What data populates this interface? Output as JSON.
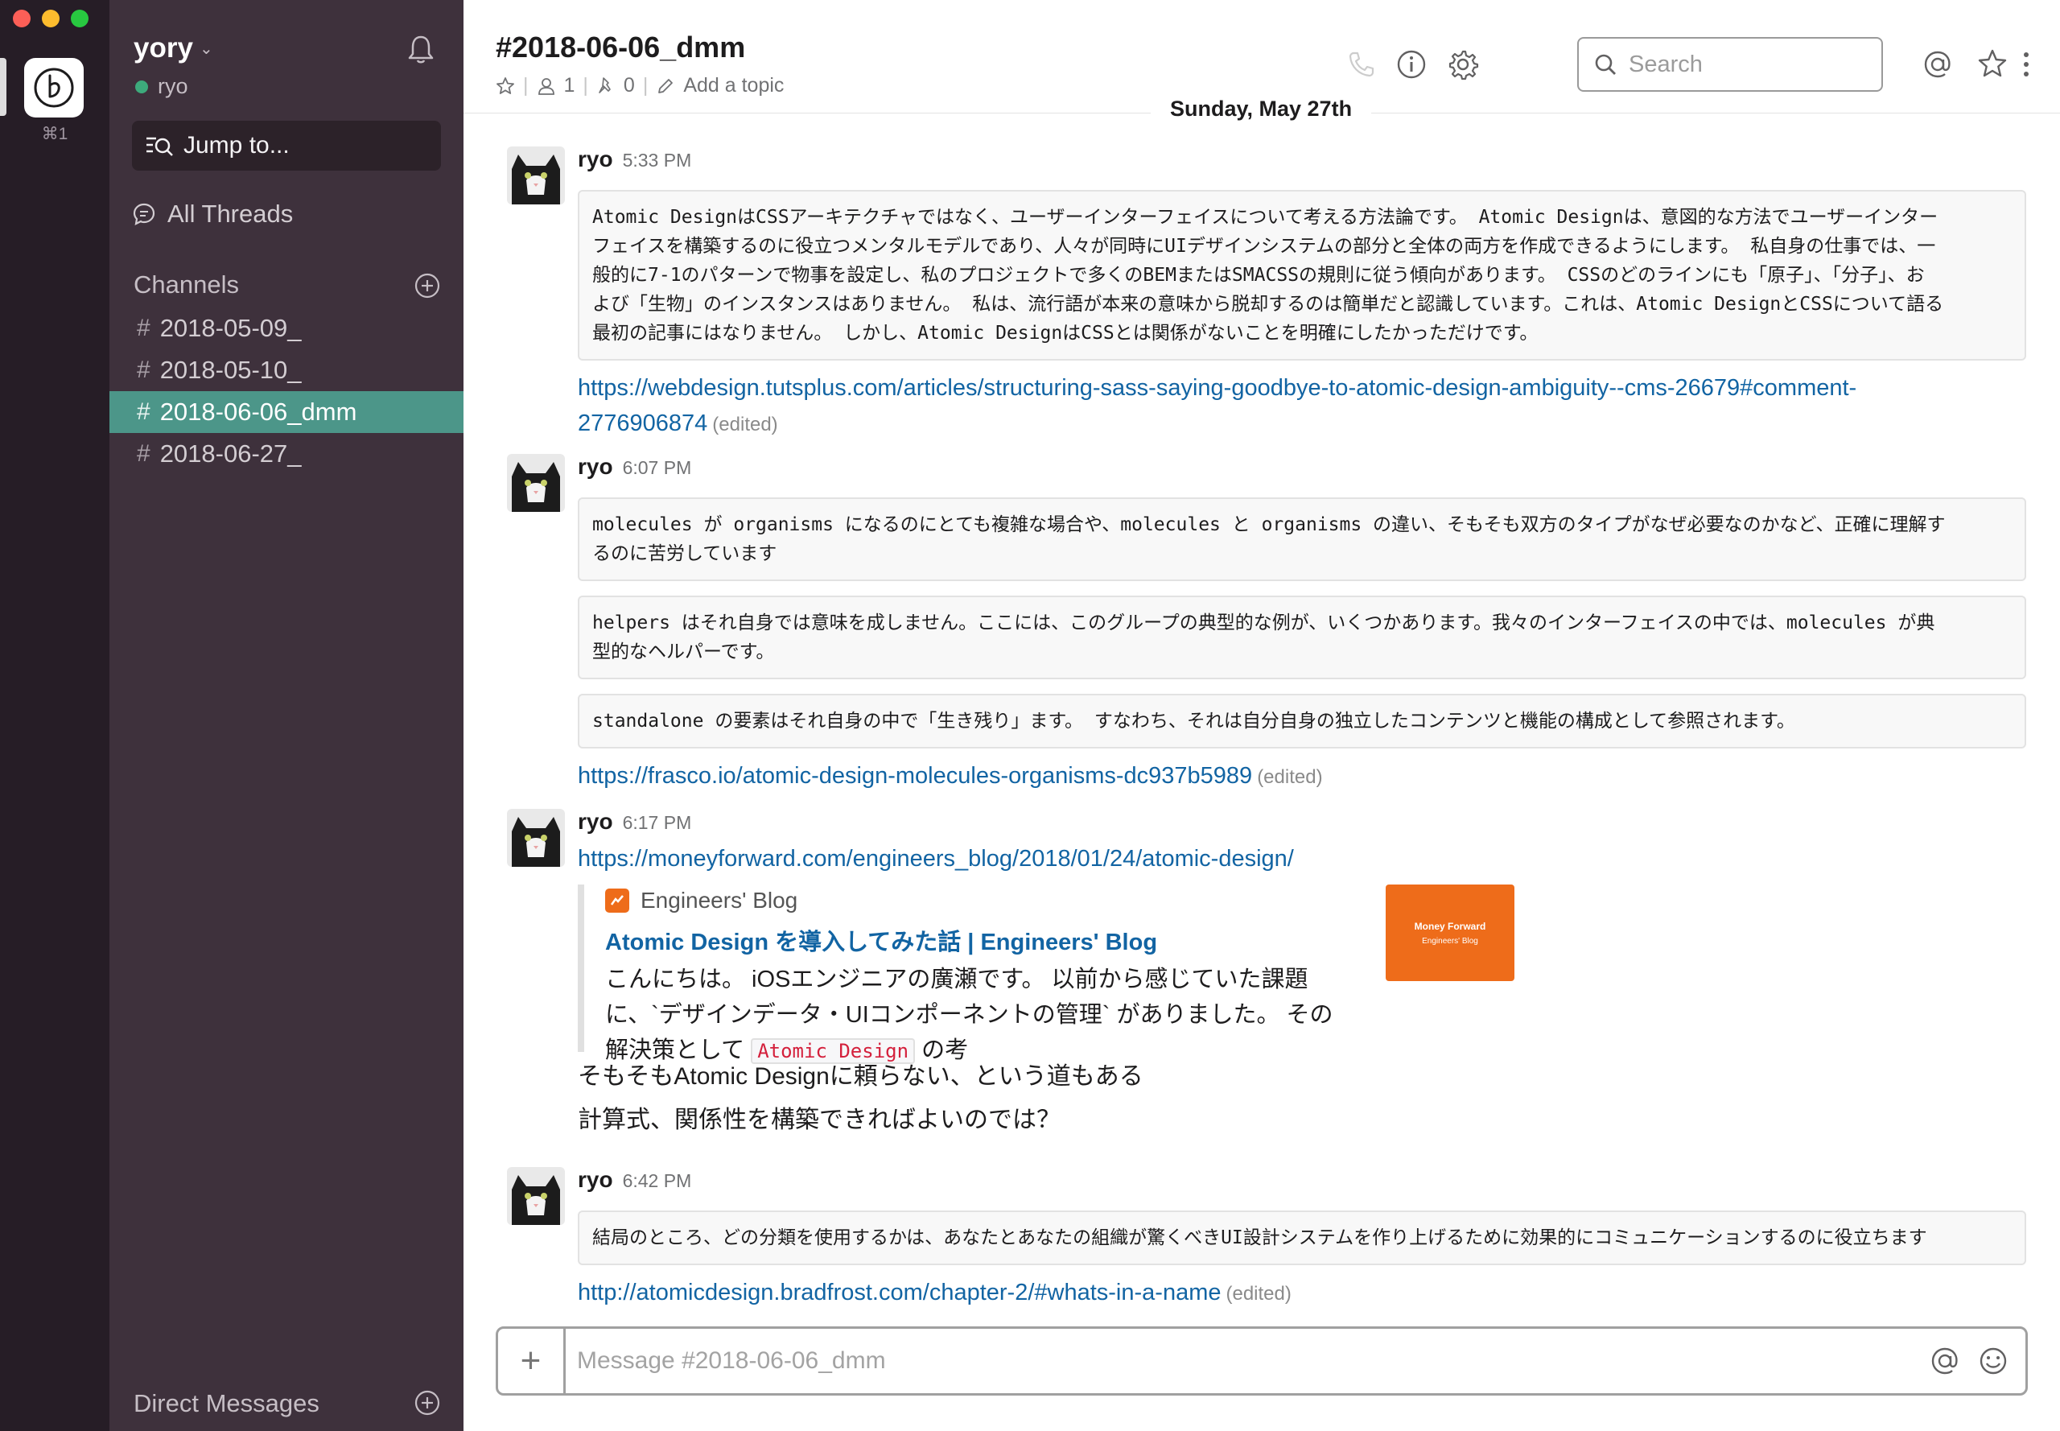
{
  "workspace": {
    "shortcut": "⌘1"
  },
  "sidebar": {
    "team_name": "yory",
    "user_name": "ryo",
    "jump_to": "Jump to...",
    "all_threads": "All Threads",
    "channels_label": "Channels",
    "channels": [
      {
        "name": "2018-05-09_"
      },
      {
        "name": "2018-05-10_"
      },
      {
        "name": "2018-06-06_dmm",
        "active": true
      },
      {
        "name": "2018-06-27_"
      }
    ],
    "dm_label": "Direct Messages"
  },
  "header": {
    "channel_title": "#2018-06-06_dmm",
    "members_count": "1",
    "pinned_count": "0",
    "add_topic": "Add a topic",
    "search_placeholder": "Search"
  },
  "day_divider": "Sunday, May 27th",
  "messages": [
    {
      "author": "ryo",
      "time": "5:33 PM",
      "quotes": [
        "Atomic DesignはCSSアーキテクチャではなく、ユーザーインターフェイスについて考える方法論です。 Atomic Designは、意図的な方法でユーザーインター",
        "フェイスを構築するのに役立つメンタルモデルであり、人々が同時にUIデザインシステムの部分と全体の両方を作成できるようにします。 私自身の仕事では、一",
        "般的に7-1のパターンで物事を設定し、私のプロジェクトで多くのBEMまたはSMACSSの規則に従う傾向があります。 CSSのどのラインにも「原子」、「分子」、お",
        "よび「生物」のインスタンスはありません。 私は、流行語が本来の意味から脱却するのは簡単だと認識しています。これは、Atomic DesignとCSSについて語る",
        "最初の記事にはなりません。 しかし、Atomic DesignはCSSとは関係がないことを明確にしたかっただけです。"
      ],
      "link_line1": "https://webdesign.tutsplus.com/articles/structuring-sass-saying-goodbye-to-atomic-design-ambiguity--cms-26679#comment-",
      "link_line2": "2776906874",
      "edited": "(edited)"
    },
    {
      "author": "ryo",
      "time": "6:07 PM",
      "quote1": [
        "molecules が organisms になるのにとても複雑な場合や、molecules と organisms の違い、そもそも双方のタイプがなぜ必要なのかなど、正確に理解す",
        "るのに苦労しています"
      ],
      "quote2": [
        "helpers はそれ自身では意味を成しません。ここには、このグループの典型的な例が、いくつかあります。我々のインターフェイスの中では、molecules が典",
        "型的なヘルパーです。"
      ],
      "quote3": [
        "standalone の要素はそれ自身の中で「生き残り」ます。 すなわち、それは自分自身の独立したコンテンツと機能の構成として参照されます。"
      ],
      "link": "https://frasco.io/atomic-design-molecules-organisms-dc937b5989",
      "edited": "(edited)"
    },
    {
      "author": "ryo",
      "time": "6:17 PM",
      "link": "https://moneyforward.com/engineers_blog/2018/01/24/atomic-design/",
      "attachment": {
        "site": "Engineers' Blog",
        "title": "Atomic Design を導入してみた話 | Engineers' Blog",
        "text_line1": "こんにちは。 iOSエンジニアの廣瀬です。 以前から感じていた課題",
        "text_line2": "に、`デザインデータ・UIコンポーネントの管理` がありました。 その",
        "text_pre": "解決策として",
        "text_code": "Atomic Design",
        "text_post": "の考",
        "thumb_line1": "Money Forward",
        "thumb_line2": "Engineers' Blog"
      },
      "text1": "そもそもAtomic Designに頼らない、という道もある",
      "text2": "計算式、関係性を構築できればよいのでは？"
    },
    {
      "author": "ryo",
      "time": "6:42 PM",
      "quote": "結局のところ、どの分類を使用するかは、あなたとあなたの組織が驚くべきUI設計システムを作り上げるために効果的にコミュニケーションするのに役立ちます",
      "link": "http://atomicdesign.bradfrost.com/chapter-2/#whats-in-a-name",
      "edited": "(edited)"
    }
  ],
  "composer": {
    "placeholder": "Message #2018-06-06_dmm"
  },
  "colors": {
    "rail": "#261d26",
    "sidebar": "#3e313c",
    "active_channel": "#4c9689",
    "link": "#1264a3",
    "presence": "#3daa7c",
    "blog_orange": "#ee6c1a"
  }
}
